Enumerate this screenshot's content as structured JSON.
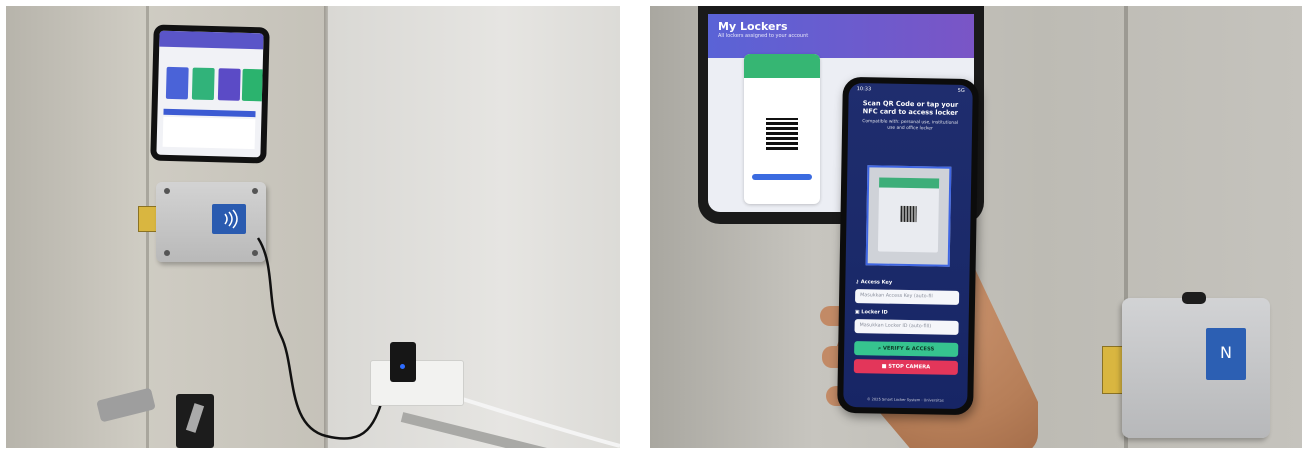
{
  "left_photo": {
    "tablet_screen_colors": [
      "#5a55c8",
      "#4a63d8",
      "#31b37a",
      "#5b4bc6",
      "#2bb36e"
    ],
    "reader_panel_color": "#2a5bb0",
    "adapter_led_color": "#2d6cff"
  },
  "right_photo": {
    "background_tablet": {
      "title": "My Lockers",
      "subtitle": "All lockers assigned to your account",
      "header_color": "#5a63d6",
      "card_header_color": "#36b673"
    },
    "phone": {
      "status_time": "10:33",
      "status_right": "5G",
      "title": "Scan QR Code or tap your NFC card to access locker",
      "subtitle": "Compatible with: personal use, institutional use and office locker",
      "access_key_label": "Access Key",
      "access_key_placeholder": "Masukkan Access Key (auto-fil",
      "locker_id_label": "Locker ID",
      "locker_id_placeholder": "Masukkan Locker ID (auto-fill)",
      "verify_button": "VERIFY & ACCESS",
      "stop_button": "STOP CAMERA",
      "footer": "© 2025 Smart Locker System · Universitas",
      "verify_color": "#36c48f",
      "stop_color": "#e3365a"
    },
    "reader_panel_color": "#2c5fb3"
  },
  "icons": {
    "key": "key-icon",
    "locker": "locker-icon",
    "search": "search-icon",
    "stop": "stop-icon",
    "nfc": "nfc-icon"
  }
}
